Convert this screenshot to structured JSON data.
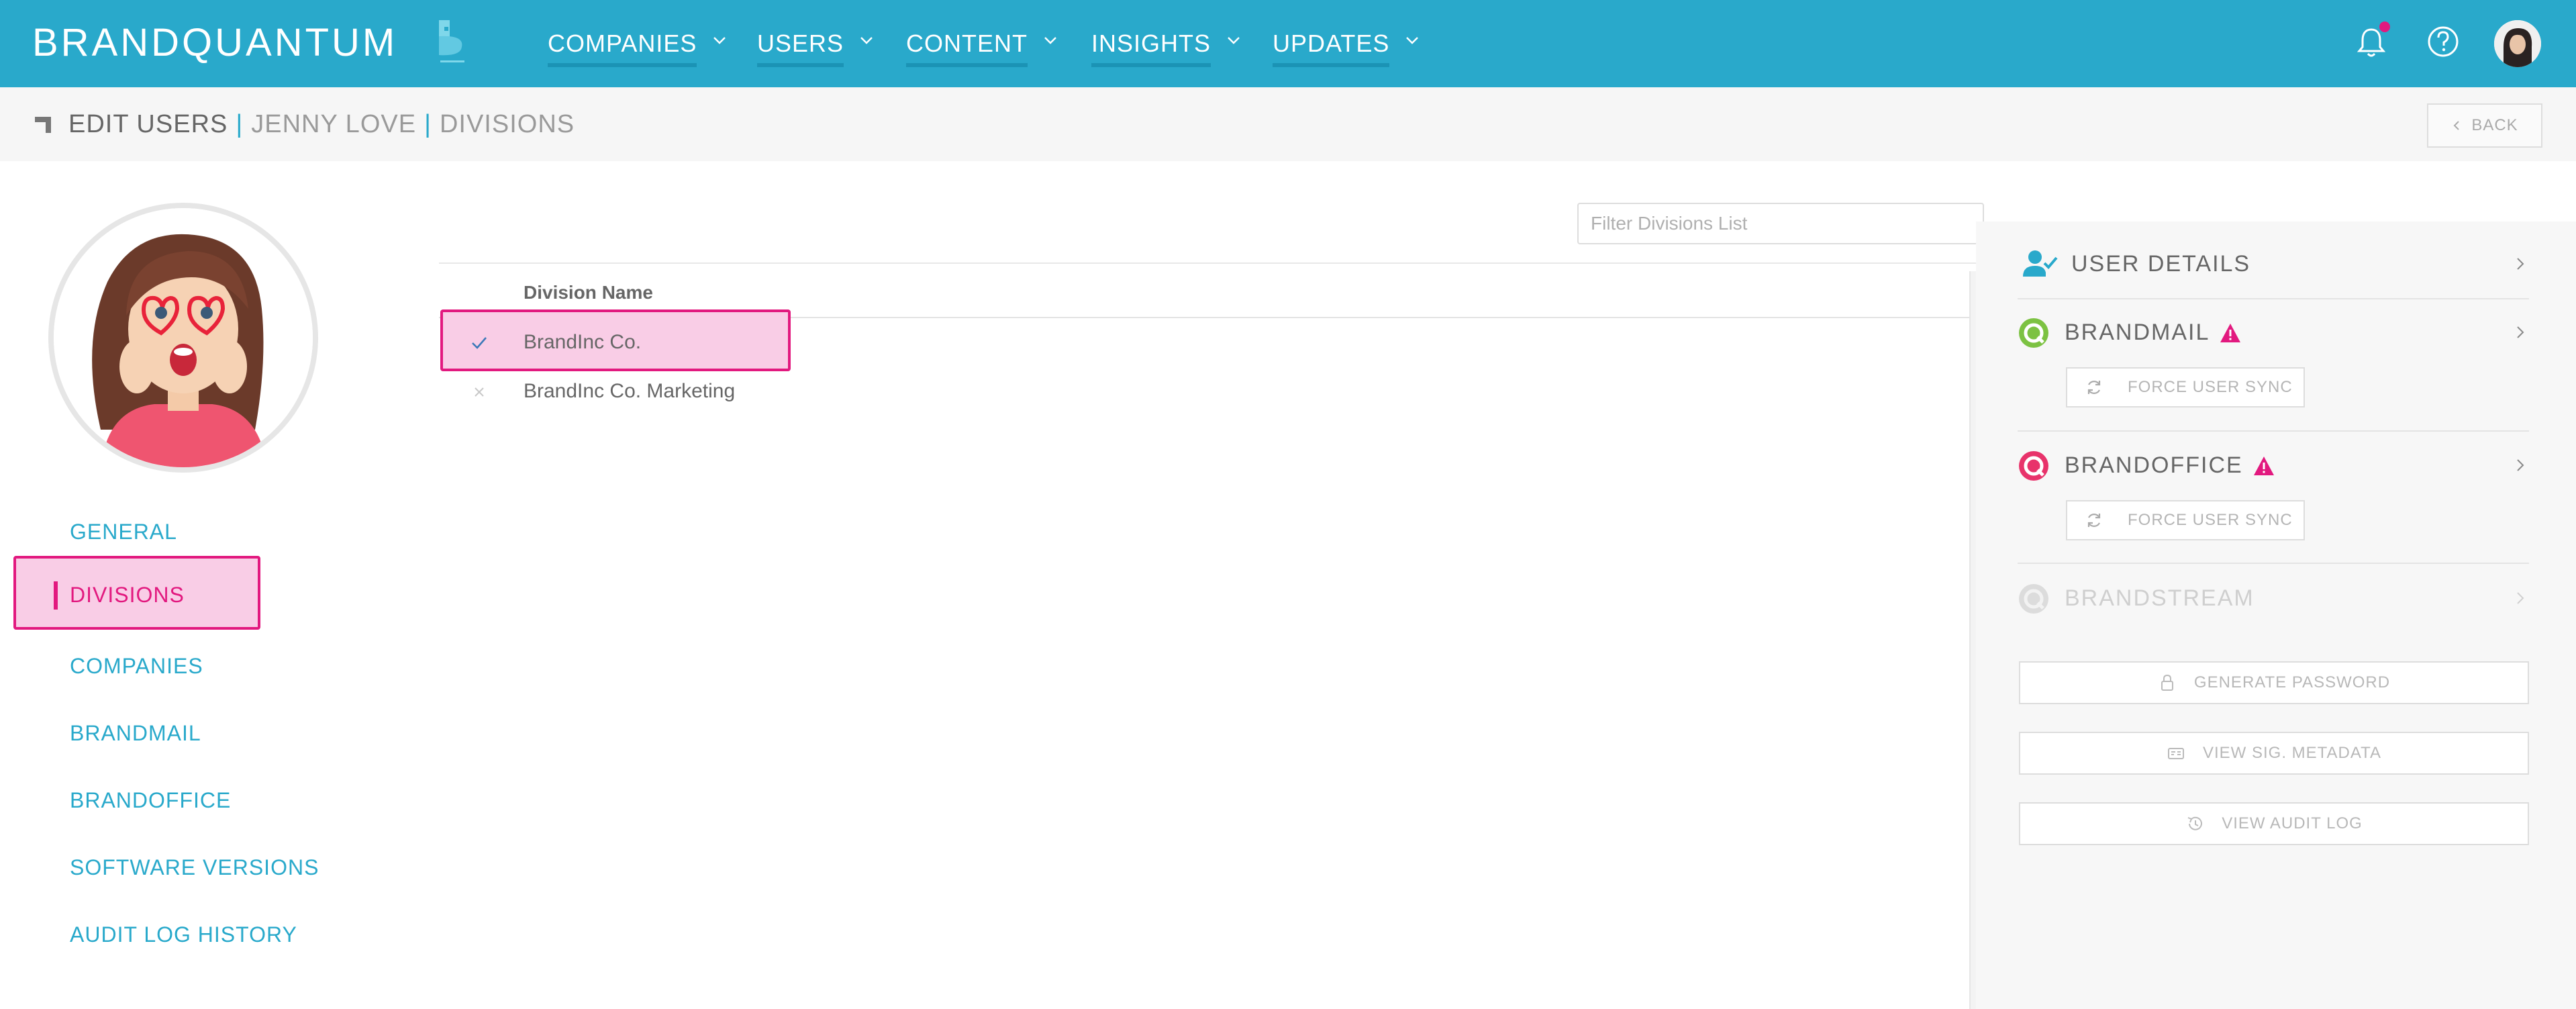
{
  "app": {
    "brand": "BRANDQUANTUM"
  },
  "nav": {
    "items": [
      {
        "label": "COMPANIES"
      },
      {
        "label": "USERS"
      },
      {
        "label": "CONTENT"
      },
      {
        "label": "INSIGHTS"
      },
      {
        "label": "UPDATES"
      }
    ],
    "icons": [
      "bell-icon",
      "help-icon",
      "user-avatar"
    ],
    "has_notification": true
  },
  "breadcrumb": {
    "section": "EDIT USERS",
    "user": "JENNY LOVE",
    "page": "DIVISIONS",
    "back_label": "BACK"
  },
  "sidebar": {
    "items": [
      {
        "label": "GENERAL",
        "active": false
      },
      {
        "label": "DIVISIONS",
        "active": true
      },
      {
        "label": "COMPANIES",
        "active": false
      },
      {
        "label": "BRANDMAIL",
        "active": false
      },
      {
        "label": "BRANDOFFICE",
        "active": false
      },
      {
        "label": "SOFTWARE VERSIONS",
        "active": false
      },
      {
        "label": "AUDIT LOG HISTORY",
        "active": false
      }
    ]
  },
  "divisions": {
    "filter_placeholder": "Filter Divisions List",
    "column_header": "Division Name",
    "rows": [
      {
        "name": "BrandInc Co.",
        "checked": true,
        "icon": "check-icon"
      },
      {
        "name": "BrandInc Co. Marketing",
        "checked": false,
        "icon": "x-icon"
      }
    ]
  },
  "right_panel": {
    "user_details": "USER DETAILS",
    "brandmail": "BRANDMAIL",
    "brandoffice": "BRANDOFFICE",
    "brandstream": "BRANDSTREAM",
    "force_sync": "FORCE USER SYNC",
    "generate_password": "GENERATE PASSWORD",
    "view_metadata": "VIEW SIG. METADATA",
    "view_audit_log": "VIEW AUDIT LOG"
  },
  "colors": {
    "primary": "#29a9cb",
    "accent": "#e2197f",
    "highlight_fill": "#f9cde6",
    "brandmail_green": "#7cc242"
  }
}
